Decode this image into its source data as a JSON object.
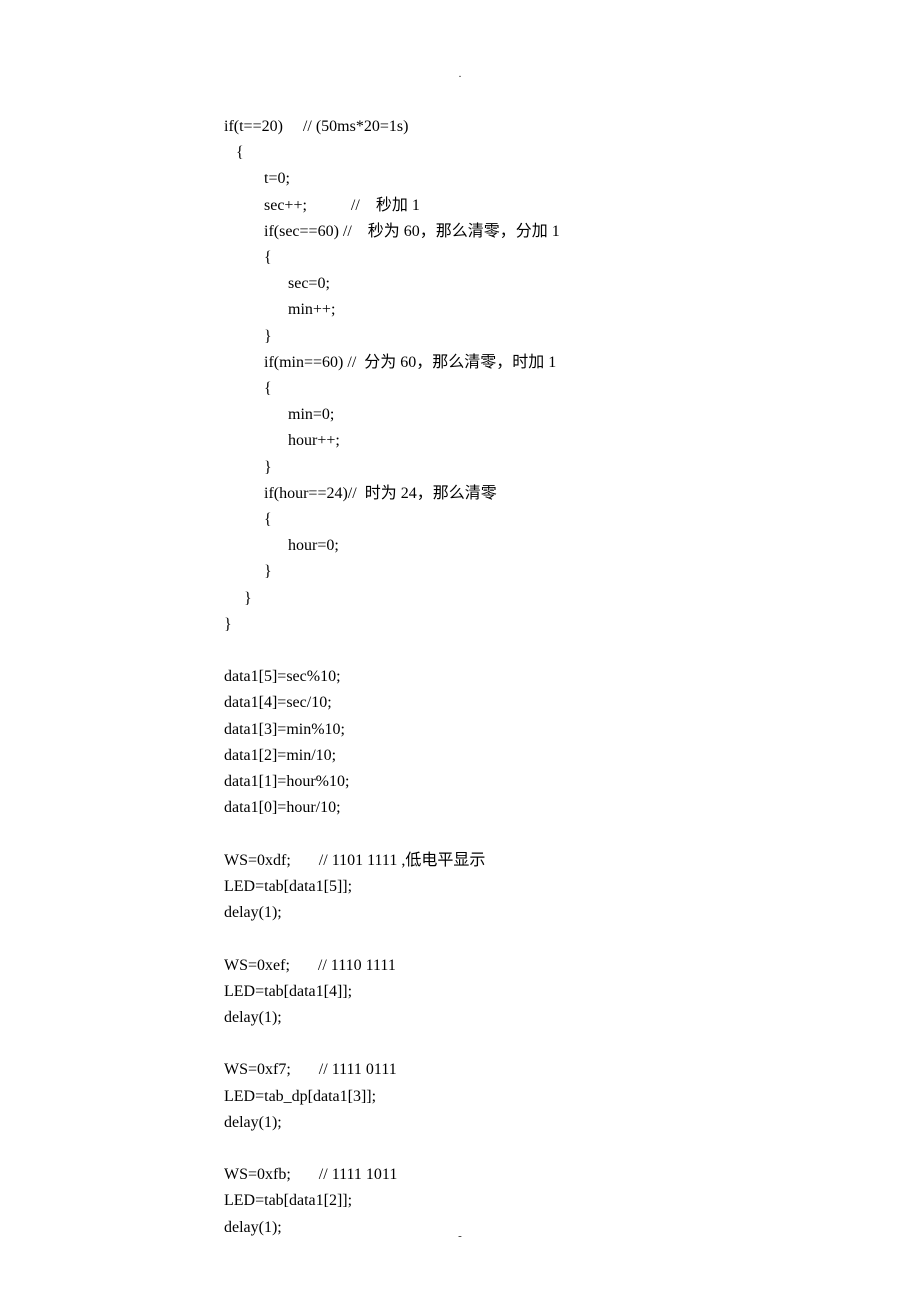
{
  "header_mark": ".",
  "footer_mark": "-",
  "code": "if(t==20)     // (50ms*20=1s)\n   {\n          t=0;\n          sec++;           //    秒加 1\n          if(sec==60) //    秒为 60，那么清零，分加 1\n          {\n                sec=0;\n                min++;\n          }\n          if(min==60) //  分为 60，那么清零，时加 1\n          {\n                min=0;\n                hour++;\n          }\n          if(hour==24)//  时为 24，那么清零\n          {\n                hour=0;\n          }\n     }\n}\n\ndata1[5]=sec%10;\ndata1[4]=sec/10;\ndata1[3]=min%10;\ndata1[2]=min/10;\ndata1[1]=hour%10;\ndata1[0]=hour/10;\n\nWS=0xdf;       // 1101 1111 ,低电平显示\nLED=tab[data1[5]];\ndelay(1);\n\nWS=0xef;       // 1110 1111\nLED=tab[data1[4]];\ndelay(1);\n\nWS=0xf7;       // 1111 0111\nLED=tab_dp[data1[3]];\ndelay(1);\n\nWS=0xfb;       // 1111 1011\nLED=tab[data1[2]];\ndelay(1);"
}
